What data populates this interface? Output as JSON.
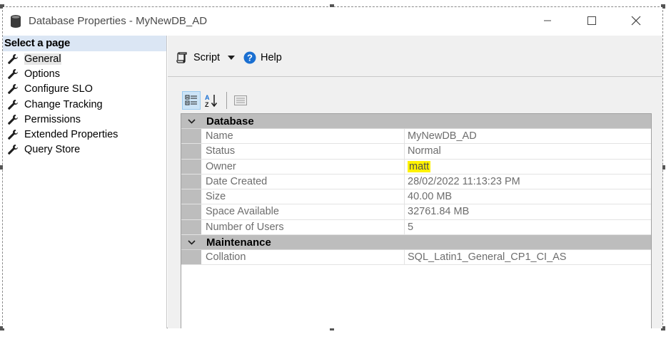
{
  "window": {
    "title": "Database Properties - MyNewDB_AD"
  },
  "sidebar": {
    "header": "Select a page",
    "items": [
      {
        "label": "General",
        "active": true
      },
      {
        "label": "Options"
      },
      {
        "label": "Configure SLO"
      },
      {
        "label": "Change Tracking"
      },
      {
        "label": "Permissions"
      },
      {
        "label": "Extended Properties"
      },
      {
        "label": "Query Store"
      }
    ]
  },
  "toolbar": {
    "script_label": "Script",
    "help_label": "Help"
  },
  "grid": {
    "categories": [
      {
        "label": "Database",
        "properties": [
          {
            "name": "Name",
            "value": "MyNewDB_AD"
          },
          {
            "name": "Status",
            "value": "Normal"
          },
          {
            "name": "Owner",
            "value": "matt",
            "highlight": true
          },
          {
            "name": "Date Created",
            "value": "28/02/2022 11:13:23 PM"
          },
          {
            "name": "Size",
            "value": "40.00 MB"
          },
          {
            "name": "Space Available",
            "value": "32761.84 MB"
          },
          {
            "name": "Number of Users",
            "value": "5"
          }
        ]
      },
      {
        "label": "Maintenance",
        "properties": [
          {
            "name": "Collation",
            "value": "SQL_Latin1_General_CP1_CI_AS"
          }
        ]
      }
    ]
  },
  "colors": {
    "highlight": "#fff200",
    "sidebar_header_bg": "#dbe6f4",
    "category_bg": "#bdbdbd",
    "help_icon": "#1a6fd1"
  },
  "icons": {
    "title": "database-icon",
    "page_item": "wrench-icon",
    "script": "script-icon",
    "help": "help-icon"
  }
}
